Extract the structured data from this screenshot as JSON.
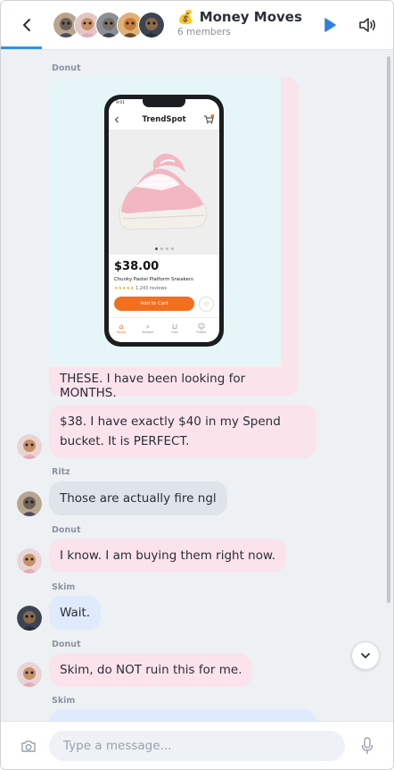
{
  "header": {
    "title_emoji": "💰",
    "title": "Money Moves",
    "members": "6 members"
  },
  "messages": [
    {
      "sender": "Donut",
      "caption": "THESE. I have been looking for MONTHS."
    },
    {
      "text_line1": "$38. I have exactly $40 in my Spend",
      "text_line2": "bucket. It is PERFECT."
    },
    {
      "sender": "Ritz",
      "text": "Those are actually fire ngl"
    },
    {
      "sender": "Donut",
      "text": "I know. I am buying them right now."
    },
    {
      "sender": "Skim",
      "text": "Wait."
    },
    {
      "sender": "Donut",
      "text": "Skim, do NOT ruin this for me."
    },
    {
      "sender": "Skim"
    }
  ],
  "product_shot": {
    "status_time": "9:01",
    "app_title": "TrendSpot",
    "price": "$38.00",
    "product_name": "Chunky Pastel Platform Sneakers",
    "stars": "★★★★★",
    "review_count": "1,243 reviews",
    "add_to_cart": "Add to Cart",
    "tabs": [
      "Home",
      "Browse",
      "Cart",
      "Profile"
    ]
  },
  "composer": {
    "placeholder": "Type a message..."
  },
  "colors": {
    "accent": "#3a8ee6",
    "donut_bubble": "#fbe3ec",
    "ritz_bubble": "#dfe4ea",
    "skim_bubble": "#dfeafd",
    "shop_orange": "#f26f1e"
  },
  "icons": {
    "back": "chevron-left-icon",
    "play": "play-icon",
    "sound": "speaker-icon",
    "scroll": "chevron-down-icon",
    "camera": "camera-icon",
    "mic": "microphone-icon"
  }
}
